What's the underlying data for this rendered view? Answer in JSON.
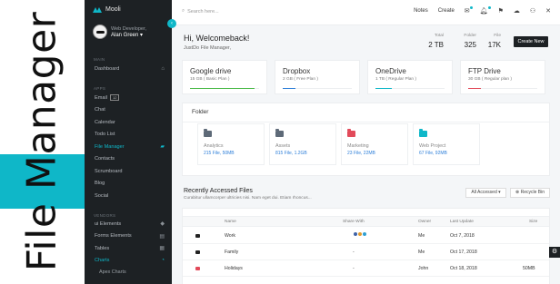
{
  "banner": {
    "text": "File Manager"
  },
  "app": {
    "logo": "Mooli",
    "toggle_icon": "chevron-left-icon",
    "user": {
      "role": "Web Developer,",
      "name": "Alan Green",
      "caret": "▾"
    }
  },
  "sidebar": {
    "main_label": "MAIN",
    "main_items": [
      {
        "label": "Dashboard",
        "icon": "home-icon",
        "glyph": "⌂"
      }
    ],
    "apps_label": "APPS",
    "apps_items": [
      {
        "label": "Email",
        "badge": "12",
        "icon": "",
        "glyph": ""
      },
      {
        "label": "Chat",
        "icon": "",
        "glyph": ""
      },
      {
        "label": "Calendar",
        "icon": "",
        "glyph": ""
      },
      {
        "label": "Todo List",
        "icon": "",
        "glyph": ""
      },
      {
        "label": "File Manager",
        "icon": "folder-icon",
        "glyph": "▰",
        "active": true
      },
      {
        "label": "Contacts",
        "icon": "",
        "glyph": ""
      },
      {
        "label": "Scrumboard",
        "icon": "",
        "glyph": ""
      },
      {
        "label": "Blog",
        "icon": "",
        "glyph": ""
      },
      {
        "label": "Social",
        "icon": "",
        "glyph": ""
      }
    ],
    "vendors_label": "VENDORS",
    "vendor_items": [
      {
        "label": "ui Elements",
        "icon": "diamond-icon",
        "glyph": "◆"
      },
      {
        "label": "Forms Elements",
        "icon": "forms-icon",
        "glyph": "▤"
      },
      {
        "label": "Tables",
        "icon": "grid-icon",
        "glyph": "▦"
      },
      {
        "label": "Charts",
        "icon": "pie-chart-icon",
        "glyph": "◔",
        "active": true
      }
    ],
    "sub_items": [
      "Apex Charts"
    ]
  },
  "topbar": {
    "search_placeholder": "Search here...",
    "notes": "Notes",
    "create": "Create"
  },
  "welcome": {
    "title": "Hi, Welcomeback!",
    "subtitle": "JustDo File Manager,"
  },
  "stats": [
    {
      "label": "Total",
      "value": "2 TB"
    },
    {
      "label": "Folder",
      "value": "325"
    },
    {
      "label": "File",
      "value": "17K"
    }
  ],
  "create_new": "Create New",
  "cloud": [
    {
      "name": "Google drive",
      "info": "15 GB ( Basic Plan )",
      "fill": 0.93,
      "color": "#49b947"
    },
    {
      "name": "Dropbox",
      "info": "2 GB ( Free Plan )",
      "fill": 0.18,
      "color": "#2e7fd9"
    },
    {
      "name": "OneDrive",
      "info": "1 TB ( Regular Plan )",
      "fill": 0.24,
      "color": "#0fb7c8"
    },
    {
      "name": "FTP Drive",
      "info": "30 GB ( Regular plan )",
      "fill": 0.18,
      "color": "#e24a5a"
    }
  ],
  "folder_panel": {
    "title": "Folder",
    "folders": [
      {
        "name": "Analytics",
        "info": "215 File, 50MB",
        "color": "#5e6a78",
        "info_color": "#2e7fd9"
      },
      {
        "name": "Assets",
        "info": "815 File, 1.2GB",
        "color": "#5e6a78",
        "info_color": "#2e7fd9"
      },
      {
        "name": "Marketing",
        "info": "23 File, 22MB",
        "color": "#e24a5a",
        "info_color": "#2e7fd9"
      },
      {
        "name": "Web Project",
        "info": "67 File, 92MB",
        "color": "#0fb7c8",
        "info_color": "#2e7fd9"
      }
    ]
  },
  "recent": {
    "title": "Recently Accessed Files",
    "subtitle": "Curabitur ullamcorper ultricies nisi. Nam eget dui. Etiam rhoncus...",
    "filter": "All Accessed ▾",
    "recycle": "⊗ Recycle Bin",
    "columns": [
      "Name",
      "Share With",
      "Owner",
      "Last Update",
      "Size"
    ],
    "rows": [
      {
        "name": "Work",
        "share": "",
        "owner": "Me",
        "date": "Oct 7, 2018",
        "size": "",
        "color": "#222"
      },
      {
        "name": "Family",
        "share": "-",
        "owner": "Me",
        "date": "Oct 17, 2018",
        "size": "",
        "color": "#222"
      },
      {
        "name": "Holidays",
        "share": "-",
        "owner": "John",
        "date": "Oct 18, 2018",
        "size": "50MB",
        "color": "#e24a5a"
      },
      {
        "name": "",
        "share": "",
        "owner": "",
        "date": "",
        "size": "",
        "color": "#222"
      }
    ]
  }
}
